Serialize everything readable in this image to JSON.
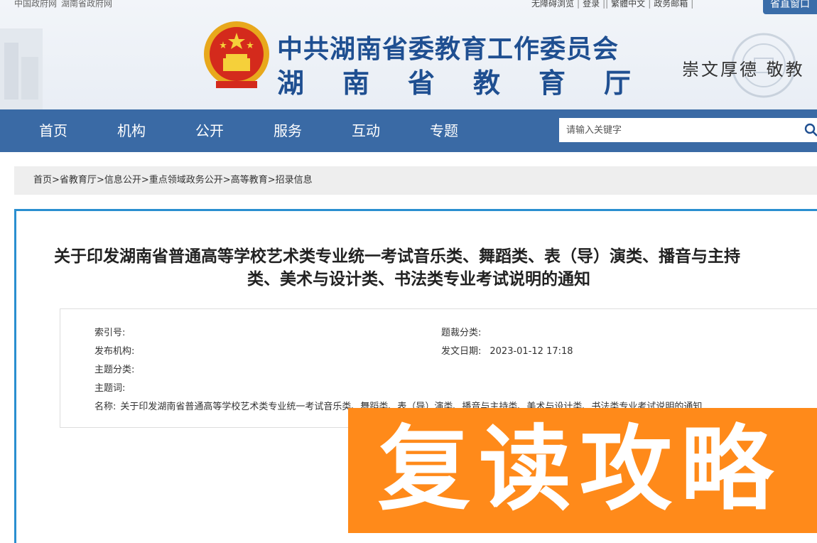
{
  "top_links": {
    "left": [
      "中国政府网",
      "湖南省政府网"
    ],
    "right": [
      "无障碍浏览",
      "登录",
      "繁體中文",
      "政务邮箱"
    ]
  },
  "window_button": "省直窗口",
  "header": {
    "title_line1": "中共湖南省委教育工作委员会",
    "title_line2": "湖南省教育厅",
    "motto": "崇文厚德  敬教"
  },
  "nav": [
    "首页",
    "机构",
    "公开",
    "服务",
    "互动",
    "专题"
  ],
  "search": {
    "placeholder": "请输入关键字"
  },
  "breadcrumb": [
    "首页",
    "省教育厅",
    "信息公开",
    "重点领域政务公开",
    "高等教育",
    "招录信息"
  ],
  "article": {
    "title_line1": "关于印发湖南省普通高等学校艺术类专业统一考试音乐类、舞蹈类、表（导）演类、播音与主持",
    "title_line2": "类、美术与设计类、书法类专业考试说明的通知"
  },
  "meta": {
    "index_label": "索引号:",
    "index_value": "",
    "category_label": "题裁分类:",
    "category_value": "",
    "publisher_label": "发布机构:",
    "publisher_value": "",
    "date_label": "发文日期:",
    "date_value": "2023-01-12 17:18",
    "topic_label": "主题分类:",
    "topic_value": "",
    "keyword_label": "主题词:",
    "keyword_value": "",
    "name_label": "名称:",
    "name_value": "关于印发湖南省普通高等学校艺术类专业统一考试音乐类、舞蹈类、表（导）演类、播音与主持类、美术与设计类、书法类专业考试说明的通知"
  },
  "watermark": "复读攻略",
  "colors": {
    "nav": "#3a6aa5",
    "title": "#1f4f91",
    "accent_border": "#2a8fd0",
    "watermark": "#ff8a1a"
  }
}
